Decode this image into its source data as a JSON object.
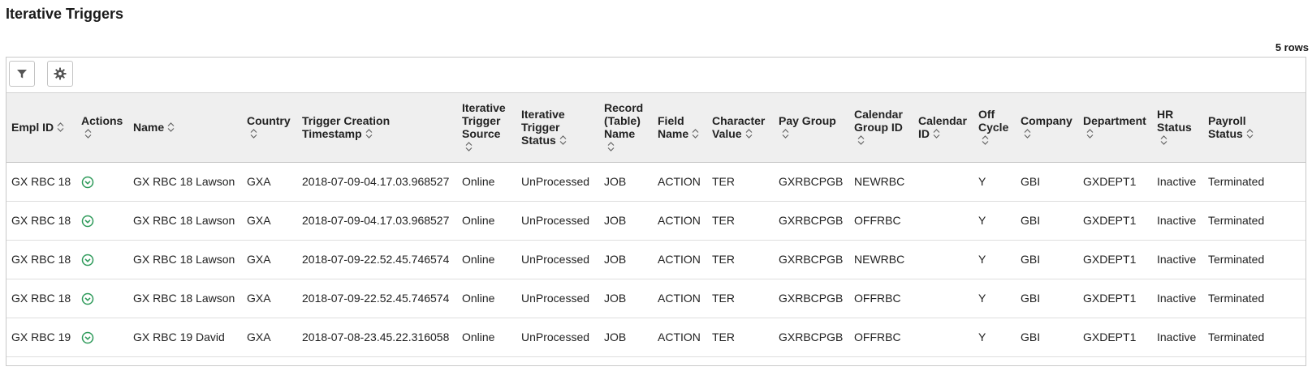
{
  "page": {
    "title": "Iterative Triggers",
    "row_count": "5 rows"
  },
  "toolbar": {
    "filter_icon": "filter-icon",
    "settings_icon": "gear-icon"
  },
  "columns": [
    {
      "line1": "Empl ID",
      "line2": "",
      "line3": "",
      "line4": ""
    },
    {
      "line1": "Actions",
      "line2": "",
      "line3": "",
      "line4": ""
    },
    {
      "line1": "Name",
      "line2": "",
      "line3": "",
      "line4": ""
    },
    {
      "line1": "Country",
      "line2": "",
      "line3": "",
      "line4": ""
    },
    {
      "line1": "Trigger Creation",
      "line2": "Timestamp",
      "line3": "",
      "line4": ""
    },
    {
      "line1": "Iterative",
      "line2": "Trigger",
      "line3": "Source",
      "line4": ""
    },
    {
      "line1": "Iterative",
      "line2": "Trigger",
      "line3": "Status",
      "line4": ""
    },
    {
      "line1": "Record",
      "line2": "(Table)",
      "line3": "Name",
      "line4": ""
    },
    {
      "line1": "Field",
      "line2": "Name",
      "line3": "",
      "line4": ""
    },
    {
      "line1": "Character",
      "line2": "Value",
      "line3": "",
      "line4": ""
    },
    {
      "line1": "Pay Group",
      "line2": "",
      "line3": "",
      "line4": ""
    },
    {
      "line1": "Calendar",
      "line2": "Group ID",
      "line3": "",
      "line4": ""
    },
    {
      "line1": "Calendar",
      "line2": "ID",
      "line3": "",
      "line4": ""
    },
    {
      "line1": "Off",
      "line2": "Cycle",
      "line3": "",
      "line4": ""
    },
    {
      "line1": "Company",
      "line2": "",
      "line3": "",
      "line4": ""
    },
    {
      "line1": "Department",
      "line2": "",
      "line3": "",
      "line4": ""
    },
    {
      "line1": "HR",
      "line2": "Status",
      "line3": "",
      "line4": ""
    },
    {
      "line1": "Payroll",
      "line2": "Status",
      "line3": "",
      "line4": ""
    }
  ],
  "rows": [
    {
      "empl_id": "GX RBC 18",
      "name": "GX RBC 18 Lawson",
      "country": "GXA",
      "timestamp": "2018-07-09-04.17.03.968527",
      "source": "Online",
      "status": "UnProcessed",
      "record": "JOB",
      "field": "ACTION",
      "char_value": "TER",
      "pay_group": "GXRBCPGB",
      "cal_group": "NEWRBC",
      "cal_id": "",
      "off_cycle": "Y",
      "company": "GBI",
      "department": "GXDEPT1",
      "hr_status": "Inactive",
      "payroll_status": "Terminated"
    },
    {
      "empl_id": "GX RBC 18",
      "name": "GX RBC 18 Lawson",
      "country": "GXA",
      "timestamp": "2018-07-09-04.17.03.968527",
      "source": "Online",
      "status": "UnProcessed",
      "record": "JOB",
      "field": "ACTION",
      "char_value": "TER",
      "pay_group": "GXRBCPGB",
      "cal_group": "OFFRBC",
      "cal_id": "",
      "off_cycle": "Y",
      "company": "GBI",
      "department": "GXDEPT1",
      "hr_status": "Inactive",
      "payroll_status": "Terminated"
    },
    {
      "empl_id": "GX RBC 18",
      "name": "GX RBC 18 Lawson",
      "country": "GXA",
      "timestamp": "2018-07-09-22.52.45.746574",
      "source": "Online",
      "status": "UnProcessed",
      "record": "JOB",
      "field": "ACTION",
      "char_value": "TER",
      "pay_group": "GXRBCPGB",
      "cal_group": "NEWRBC",
      "cal_id": "",
      "off_cycle": "Y",
      "company": "GBI",
      "department": "GXDEPT1",
      "hr_status": "Inactive",
      "payroll_status": "Terminated"
    },
    {
      "empl_id": "GX RBC 18",
      "name": "GX RBC 18 Lawson",
      "country": "GXA",
      "timestamp": "2018-07-09-22.52.45.746574",
      "source": "Online",
      "status": "UnProcessed",
      "record": "JOB",
      "field": "ACTION",
      "char_value": "TER",
      "pay_group": "GXRBCPGB",
      "cal_group": "OFFRBC",
      "cal_id": "",
      "off_cycle": "Y",
      "company": "GBI",
      "department": "GXDEPT1",
      "hr_status": "Inactive",
      "payroll_status": "Terminated"
    },
    {
      "empl_id": "GX RBC 19",
      "name": "GX RBC 19 David",
      "country": "GXA",
      "timestamp": "2018-07-08-23.45.22.316058",
      "source": "Online",
      "status": "UnProcessed",
      "record": "JOB",
      "field": "ACTION",
      "char_value": "TER",
      "pay_group": "GXRBCPGB",
      "cal_group": "OFFRBC",
      "cal_id": "",
      "off_cycle": "Y",
      "company": "GBI",
      "department": "GXDEPT1",
      "hr_status": "Inactive",
      "payroll_status": "Terminated"
    }
  ],
  "colors": {
    "header_bg": "#efefef",
    "border": "#c9c9c9",
    "action_green": "#2e9a5a",
    "icon_gray": "#555555"
  }
}
